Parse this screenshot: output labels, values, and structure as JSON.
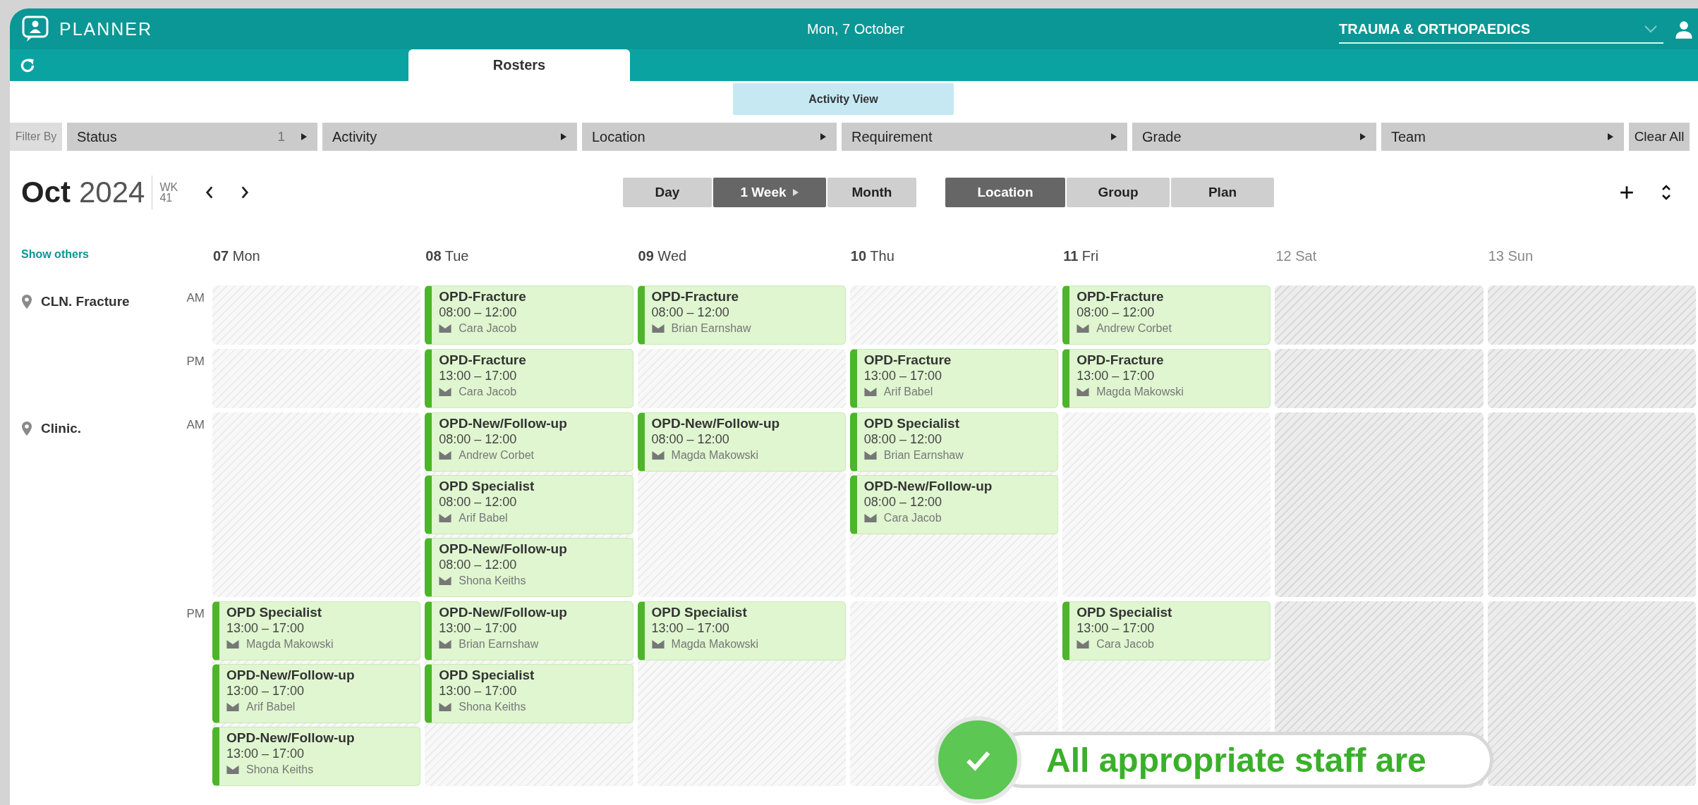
{
  "app": {
    "title": "PLANNER",
    "date": "Mon, 7 October",
    "department": "TRAUMA & ORTHOPAEDICS"
  },
  "tabs": [
    {
      "label": "Rosters",
      "selected": true
    }
  ],
  "view_button": "Activity View",
  "filter_label": "Filter By",
  "filters": [
    {
      "label": "Status",
      "count": "1"
    },
    {
      "label": "Activity"
    },
    {
      "label": "Location"
    },
    {
      "label": "Requirement"
    },
    {
      "label": "Grade"
    },
    {
      "label": "Team"
    }
  ],
  "clear_all": "Clear All",
  "period": {
    "month": "Oct",
    "year": "2024",
    "week_label": "WK",
    "week": "41"
  },
  "ranges": [
    {
      "label": "Day",
      "selected": false
    },
    {
      "label": "1 Week",
      "selected": true
    },
    {
      "label": "Month",
      "selected": false
    }
  ],
  "groupings": [
    {
      "label": "Location",
      "selected": true
    },
    {
      "label": "Group",
      "selected": false
    },
    {
      "label": "Plan",
      "selected": false
    }
  ],
  "show_others": "Show others",
  "days": [
    {
      "num": "07",
      "name": "Mon",
      "weekend": false
    },
    {
      "num": "08",
      "name": "Tue",
      "weekend": false
    },
    {
      "num": "09",
      "name": "Wed",
      "weekend": false
    },
    {
      "num": "10",
      "name": "Thu",
      "weekend": false
    },
    {
      "num": "11",
      "name": "Fri",
      "weekend": false
    },
    {
      "num": "12",
      "name": "Sat",
      "weekend": true
    },
    {
      "num": "13",
      "name": "Sun",
      "weekend": true
    }
  ],
  "locations": [
    {
      "name": "CLN. Fracture",
      "sessions": [
        {
          "label": "AM",
          "cells": [
            {},
            {
              "events": [
                {
                  "title": "OPD-Fracture",
                  "time": "08:00 – 12:00",
                  "person": "Cara Jacob"
                }
              ]
            },
            {
              "events": [
                {
                  "title": "OPD-Fracture",
                  "time": "08:00 – 12:00",
                  "person": "Brian Earnshaw"
                }
              ]
            },
            {},
            {
              "events": [
                {
                  "title": "OPD-Fracture",
                  "time": "08:00 – 12:00",
                  "person": "Andrew Corbet"
                }
              ]
            },
            {},
            {}
          ]
        },
        {
          "label": "PM",
          "cells": [
            {},
            {
              "events": [
                {
                  "title": "OPD-Fracture",
                  "time": "13:00 – 17:00",
                  "person": "Cara Jacob"
                }
              ]
            },
            {},
            {
              "events": [
                {
                  "title": "OPD-Fracture",
                  "time": "13:00 – 17:00",
                  "person": "Arif Babel"
                }
              ]
            },
            {
              "events": [
                {
                  "title": "OPD-Fracture",
                  "time": "13:00 – 17:00",
                  "person": "Magda Makowski"
                }
              ]
            },
            {},
            {}
          ]
        }
      ]
    },
    {
      "name": "Clinic.",
      "sessions": [
        {
          "label": "AM",
          "cells": [
            {},
            {
              "events": [
                {
                  "title": "OPD-New/Follow-up",
                  "time": "08:00 – 12:00",
                  "person": "Andrew Corbet"
                },
                {
                  "title": "OPD Specialist",
                  "time": "08:00 – 12:00",
                  "person": "Arif Babel"
                },
                {
                  "title": "OPD-New/Follow-up",
                  "time": "08:00 – 12:00",
                  "person": "Shona Keiths"
                }
              ]
            },
            {
              "events": [
                {
                  "title": "OPD-New/Follow-up",
                  "time": "08:00 – 12:00",
                  "person": "Magda Makowski"
                }
              ]
            },
            {
              "events": [
                {
                  "title": "OPD Specialist",
                  "time": "08:00 – 12:00",
                  "person": "Brian Earnshaw"
                },
                {
                  "title": "OPD-New/Follow-up",
                  "time": "08:00 – 12:00",
                  "person": "Cara Jacob"
                }
              ]
            },
            {},
            {},
            {}
          ]
        },
        {
          "label": "PM",
          "cells": [
            {
              "events": [
                {
                  "title": "OPD Specialist",
                  "time": "13:00 – 17:00",
                  "person": "Magda Makowski"
                },
                {
                  "title": "OPD-New/Follow-up",
                  "time": "13:00 – 17:00",
                  "person": "Arif Babel"
                },
                {
                  "title": "OPD-New/Follow-up",
                  "time": "13:00 – 17:00",
                  "person": "Shona Keiths"
                }
              ]
            },
            {
              "events": [
                {
                  "title": "OPD-New/Follow-up",
                  "time": "13:00 – 17:00",
                  "person": "Brian Earnshaw"
                },
                {
                  "title": "OPD Specialist",
                  "time": "13:00 – 17:00",
                  "person": "Shona Keiths"
                }
              ]
            },
            {
              "events": [
                {
                  "title": "OPD Specialist",
                  "time": "13:00 – 17:00",
                  "person": "Magda Makowski"
                }
              ]
            },
            {},
            {
              "events": [
                {
                  "title": "OPD Specialist",
                  "time": "13:00 – 17:00",
                  "person": "Cara Jacob"
                }
              ]
            },
            {},
            {}
          ]
        }
      ]
    }
  ],
  "callout": {
    "text": "All appropriate staff are"
  }
}
